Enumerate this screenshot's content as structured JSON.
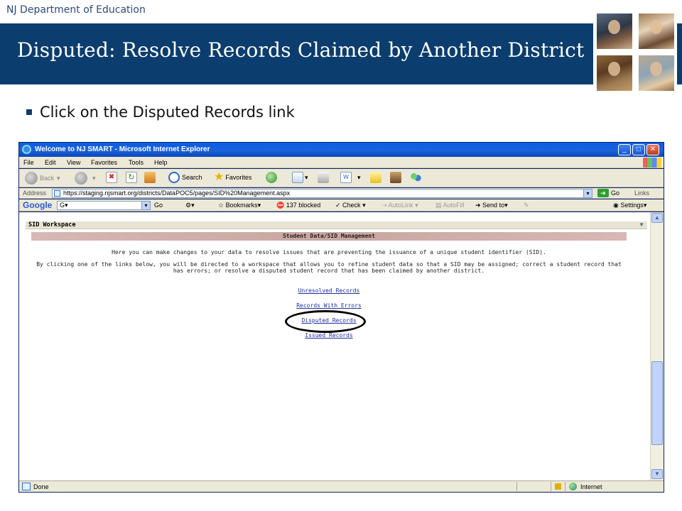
{
  "slide": {
    "org": "NJ Department of Education",
    "title": "Disputed: Resolve Records Claimed by Another District",
    "bullet": "Click on the Disputed Records link"
  },
  "colors": {
    "title_band": "#0b3d6e",
    "link": "#1d2f9c",
    "panel_header": "#c9a6a0"
  },
  "browser": {
    "window_title": "Welcome to NJ SMART - Microsoft Internet Explorer",
    "window_buttons": {
      "minimize": "_",
      "maximize": "□",
      "close": "✕"
    },
    "menu": [
      "File",
      "Edit",
      "View",
      "Favorites",
      "Tools",
      "Help"
    ],
    "toolbar": {
      "back": "Back",
      "search": "Search",
      "favorites": "Favorites"
    },
    "address": {
      "label": "Address",
      "url": "https://staging.njsmart.org/districts/DataPOC5/pages/SID%20Management.aspx",
      "go": "Go",
      "links": "Links"
    },
    "google": {
      "logo": "Google",
      "field_value": "G▾",
      "go": "Go",
      "bookmarks": "Bookmarks▾",
      "blocked": "137 blocked",
      "check": "Check",
      "autolink": "AutoLink",
      "autofill": "AutoFill",
      "send_to": "Send to▾",
      "settings": "Settings▾"
    },
    "status": {
      "text": "Done",
      "zone": "Internet"
    }
  },
  "page": {
    "workspace_title": "SID Workspace",
    "panel_title": "Student Data/SID Management",
    "description1": "Here you can make changes to your data to resolve issues that are preventing the issuance of a unique student identifier (SID).",
    "description2": "By clicking one of the links below, you will be directed to a workspace that allows you to refine student data so that a SID may be assigned; correct a student record that has errors; or resolve a disputed student record that has been claimed by another district.",
    "links": [
      "Unresolved Records",
      "Records With Errors",
      "Disputed Records",
      "Issued Records"
    ]
  }
}
